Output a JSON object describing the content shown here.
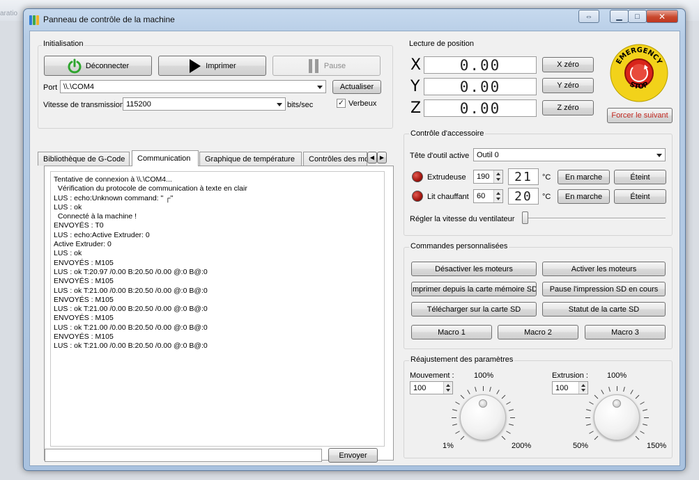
{
  "background": {
    "ghost_text_1": "aratio",
    "ghost_text_2": "",
    "ghost_text_3": ""
  },
  "window": {
    "title": "Panneau de contrôle de la machine",
    "restore_glyph": "⇔",
    "min_glyph": "▁",
    "max_glyph": "□",
    "close_glyph": "✕"
  },
  "initialisation": {
    "title": "Initialisation",
    "disconnect_label": "Déconnecter",
    "print_label": "Imprimer",
    "pause_label": "Pause",
    "port_label": "Port",
    "port_value": "\\\\.\\COM4",
    "refresh_label": "Actualiser",
    "baud_label": "Vitesse de transmission",
    "baud_value": "115200",
    "baud_unit": "bits/sec",
    "verbose_label": "Verbeux",
    "verbose_checked": true
  },
  "tabs": [
    {
      "label": "Bibliothèque de G-Code"
    },
    {
      "label": "Communication"
    },
    {
      "label": "Graphique de température"
    },
    {
      "label": "Contrôles des mo"
    }
  ],
  "log": {
    "lines": [
      "Tentative de connexion à \\\\.\\COM4...",
      "  Vérification du protocole de communication à texte en clair",
      "LUS : echo:Unknown command: \" ┌\"",
      "LUS : ok",
      "  Connecté à la machine !",
      "ENVOYÉS : T0",
      "LUS : echo:Active Extruder: 0",
      "Active Extruder: 0",
      "LUS : ok",
      "ENVOYÉS : M105",
      "LUS : ok T:20.97 /0.00 B:20.50 /0.00 @:0 B@:0",
      "ENVOYÉS : M105",
      "LUS : ok T:21.00 /0.00 B:20.50 /0.00 @:0 B@:0",
      "ENVOYÉS : M105",
      "LUS : ok T:21.00 /0.00 B:20.50 /0.00 @:0 B@:0",
      "ENVOYÉS : M105",
      "LUS : ok T:21.00 /0.00 B:20.50 /0.00 @:0 B@:0",
      "ENVOYÉS : M105",
      "LUS : ok T:21.00 /0.00 B:20.50 /0.00 @:0 B@:0"
    ],
    "send_label": "Envoyer",
    "command_value": ""
  },
  "position": {
    "title": "Lecture de position",
    "x_axis": "X",
    "y_axis": "Y",
    "z_axis": "Z",
    "x_value": "0.00",
    "y_value": "0.00",
    "z_value": "0.00",
    "x_zero_label": "X zéro",
    "y_zero_label": "Y zéro",
    "z_zero_label": "Z zéro",
    "estop_top": "EMERGENCY",
    "estop_bottom": "STOP",
    "force_next_label": "Forcer le suivant"
  },
  "accessory": {
    "title": "Contrôle d'accessoire",
    "tool_label": "Tête d'outil active",
    "tool_value": "Outil 0",
    "extruder_label": "Extrudeuse",
    "extruder_target": "190",
    "extruder_temp": "21",
    "bed_label": "Lit chauffant",
    "bed_target": "60",
    "bed_temp": "20",
    "temp_unit": "°C",
    "on_label": "En marche",
    "off_label": "Éteint",
    "fan_label": "Régler la vitesse du ventilateur",
    "fan_level": 0
  },
  "custom": {
    "title": "Commandes personnalisées",
    "disable_motors": "Désactiver les moteurs",
    "enable_motors": "Activer les moteurs",
    "print_sd": "Imprimer depuis la carte mémoire SD",
    "pause_sd": "Pause l'impression SD en cours",
    "upload_sd": "Télécharger sur la carte SD",
    "sd_status": "Statut de la carte SD",
    "macro1": "Macro 1",
    "macro2": "Macro 2",
    "macro3": "Macro 3"
  },
  "adjust": {
    "title": "Réajustement des paramètres",
    "movement_label": "Mouvement :",
    "movement_value": "100",
    "movement_center": "100%",
    "movement_min": "1%",
    "movement_max": "200%",
    "extrusion_label": "Extrusion :",
    "extrusion_value": "100",
    "extrusion_center": "100%",
    "extrusion_min": "50%",
    "extrusion_max": "150%"
  },
  "colors": {
    "power_green": "#2fa52f",
    "estop_red": "#d8241a",
    "estop_yellow": "#f2d21a",
    "force_red": "#c0271f"
  }
}
